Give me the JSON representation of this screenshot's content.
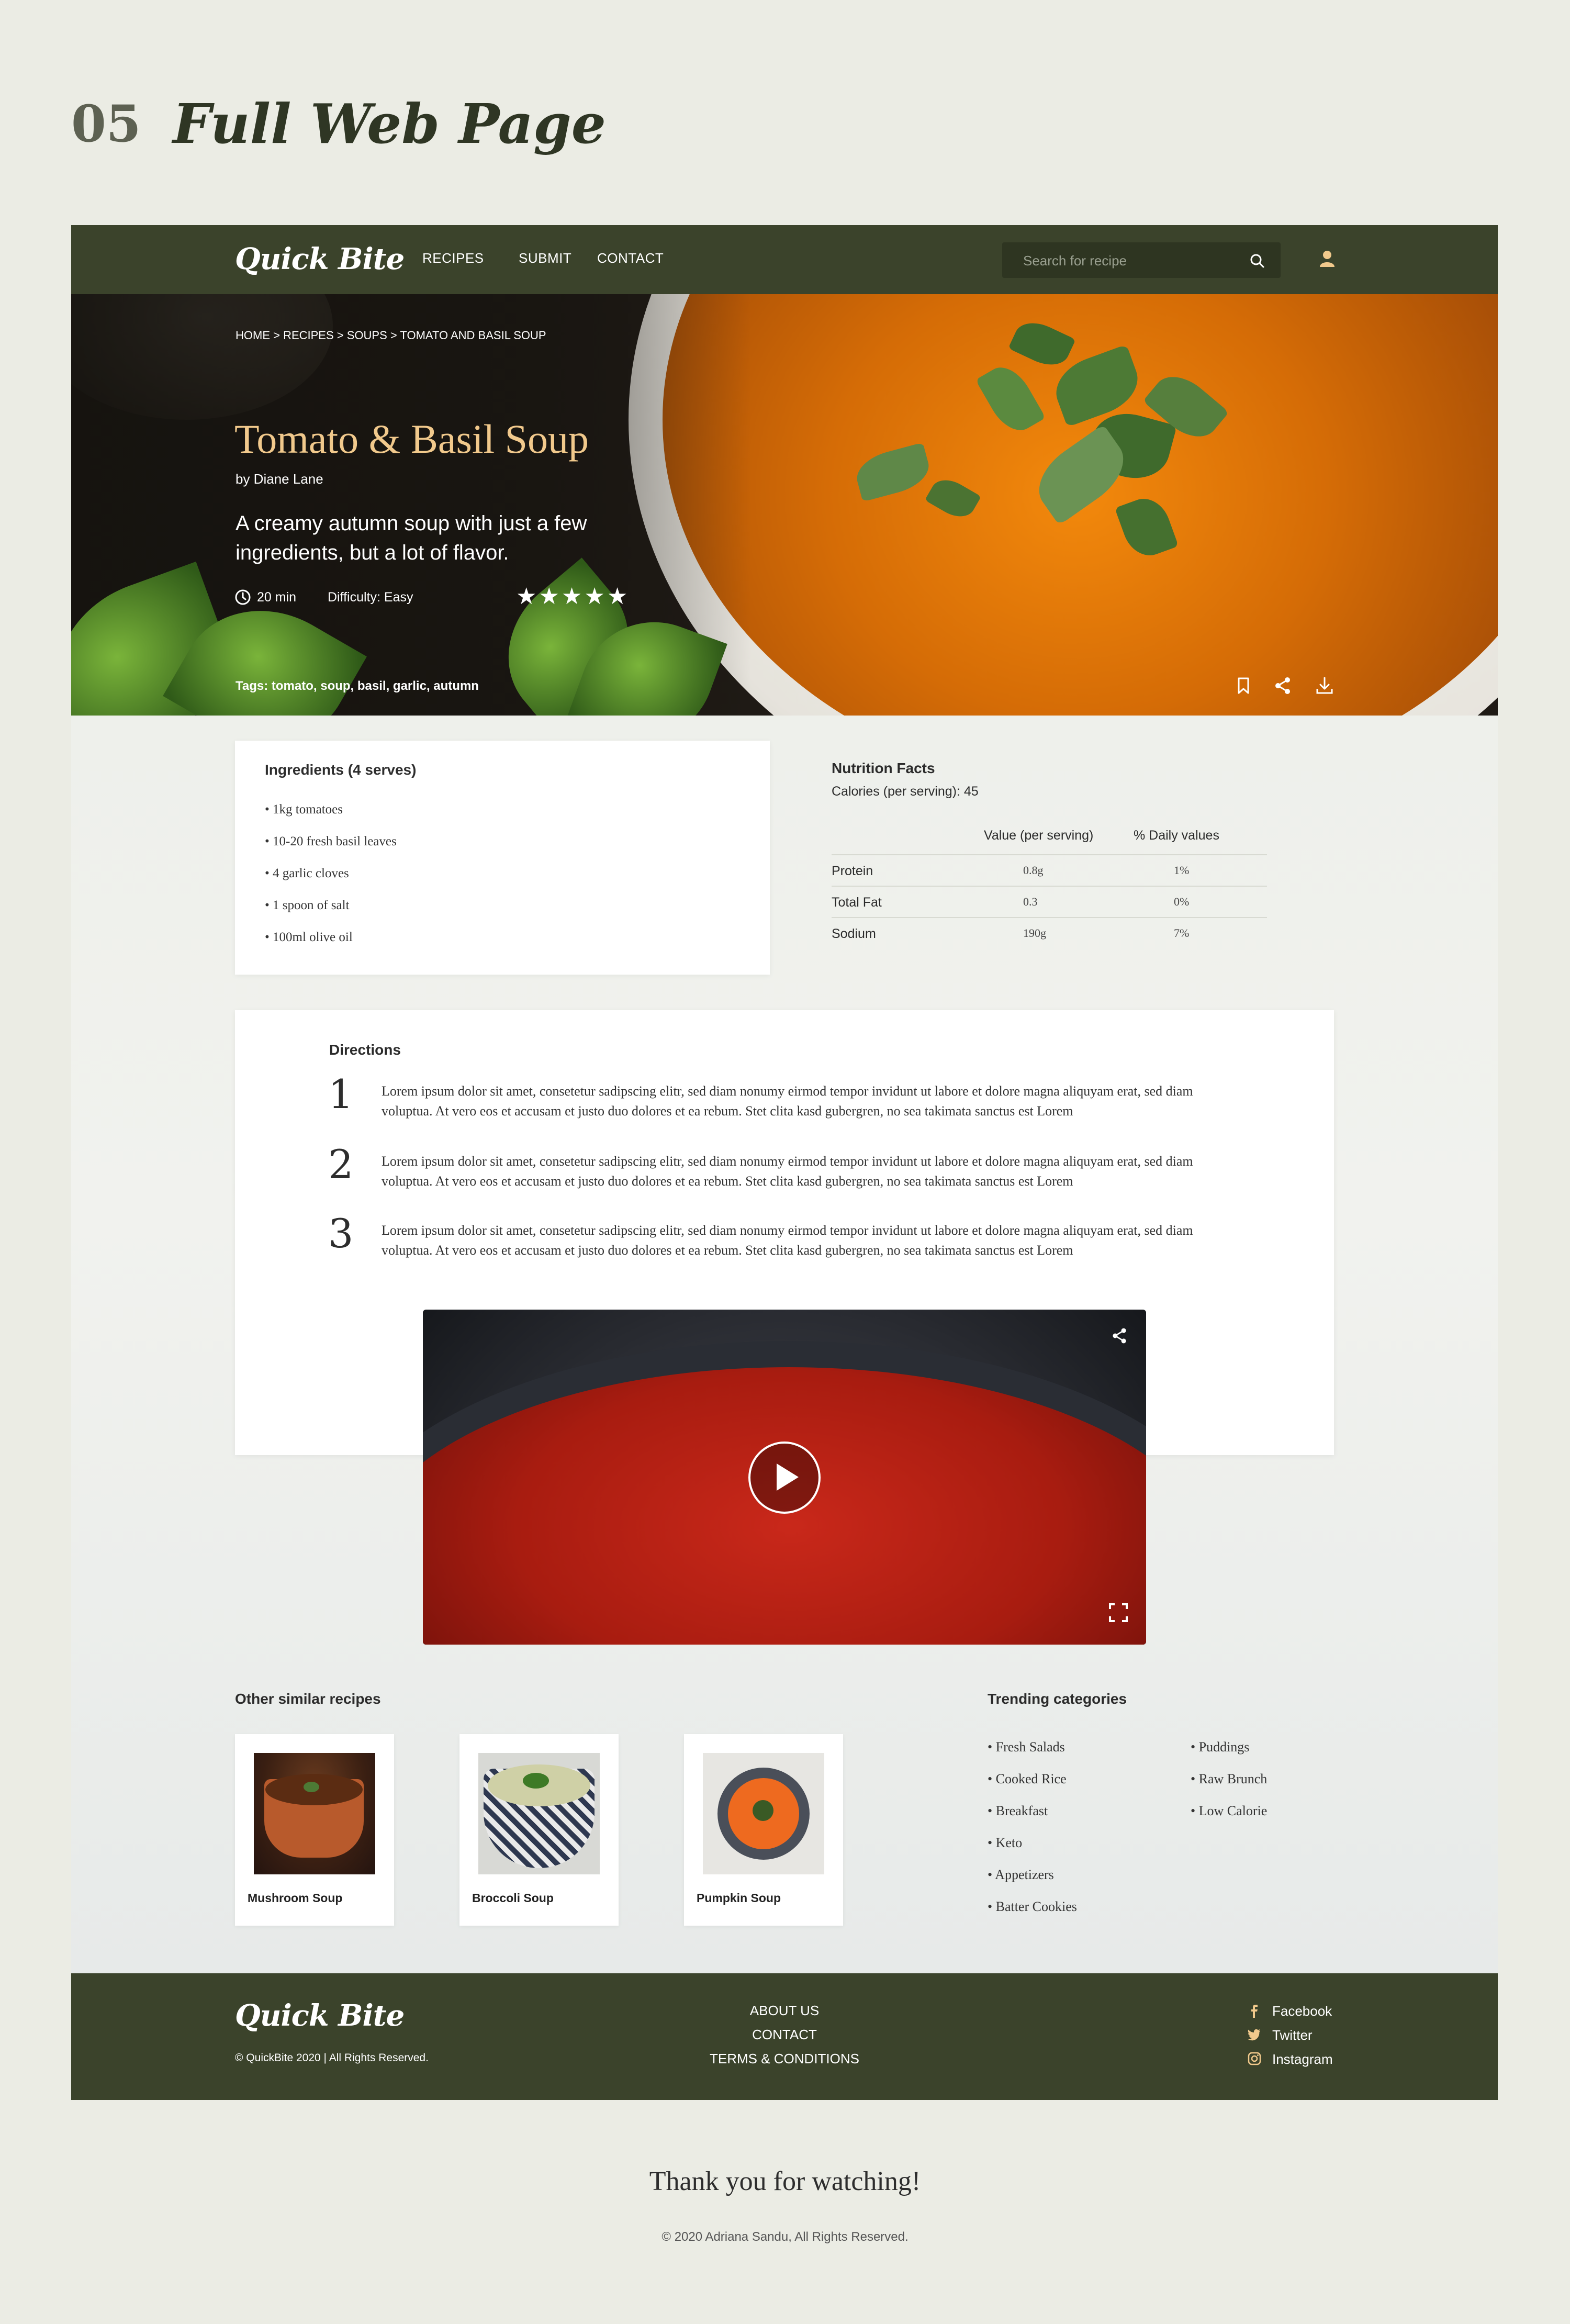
{
  "page_header": {
    "number": "05",
    "title": "Full Web Page"
  },
  "nav": {
    "logo": "Quick Bite",
    "links": [
      "RECIPES",
      "SUBMIT",
      "CONTACT"
    ],
    "search_placeholder": "Search for recipe"
  },
  "hero": {
    "breadcrumb": "HOME > RECIPES > SOUPS > TOMATO AND BASIL SOUP",
    "title": "Tomato & Basil Soup",
    "author": "by Diane Lane",
    "tagline": "A creamy autumn soup with just a few ingredients, but a lot of flavor.",
    "time": "20 min",
    "difficulty": "Difficulty: Easy",
    "rating": 5,
    "tags": "Tags: tomato, soup, basil, garlic, autumn"
  },
  "ingredients": {
    "title": "Ingredients (4 serves)",
    "items": [
      "• 1kg tomatoes",
      "• 10-20 fresh basil leaves",
      "• 4 garlic cloves",
      "• 1 spoon of salt",
      "• 100ml olive oil"
    ]
  },
  "nutrition": {
    "title": "Nutrition Facts",
    "calories": "Calories (per serving): 45",
    "headers": [
      "Value (per serving)",
      "% Daily values"
    ],
    "rows": [
      {
        "name": "Protein",
        "value": "0.8g",
        "daily": "1%"
      },
      {
        "name": "Total Fat",
        "value": "0.3",
        "daily": "0%"
      },
      {
        "name": "Sodium",
        "value": "190g",
        "daily": "7%"
      }
    ]
  },
  "directions": {
    "title": "Directions",
    "steps": [
      {
        "num": "1",
        "text": "Lorem ipsum dolor sit amet, consetetur sadipscing elitr, sed diam nonumy eirmod tempor invidunt ut labore et dolore magna aliquyam erat, sed diam voluptua. At vero eos et accusam et justo duo dolores et ea rebum. Stet clita kasd gubergren, no sea takimata sanctus est Lorem"
      },
      {
        "num": "2",
        "text": "Lorem ipsum dolor sit amet, consetetur sadipscing elitr, sed diam nonumy eirmod tempor invidunt ut labore et dolore magna aliquyam erat, sed diam voluptua. At vero eos et accusam et justo duo dolores et ea rebum. Stet clita kasd gubergren, no sea takimata sanctus est Lorem"
      },
      {
        "num": "3",
        "text": "Lorem ipsum dolor sit amet, consetetur sadipscing elitr, sed diam nonumy eirmod tempor invidunt ut labore et dolore magna aliquyam erat, sed diam voluptua. At vero eos et accusam et justo duo dolores et ea rebum. Stet clita kasd gubergren, no sea takimata sanctus est Lorem"
      }
    ]
  },
  "similar": {
    "title": "Other similar recipes",
    "items": [
      "Mushroom Soup",
      "Broccoli Soup",
      "Pumpkin Soup"
    ]
  },
  "trending": {
    "title": "Trending categories",
    "col1": [
      "• Fresh Salads",
      "• Cooked Rice",
      "• Breakfast",
      "• Keto",
      "• Appetizers",
      "• Batter Cookies"
    ],
    "col2": [
      "• Puddings",
      "• Raw Brunch",
      "• Low Calorie"
    ]
  },
  "footer": {
    "logo": "Quick Bite",
    "copyright": "© QuickBite 2020 | All Rights Reserved.",
    "links": [
      "ABOUT US",
      "CONTACT",
      "TERMS & CONDITIONS"
    ],
    "social": [
      "Facebook",
      "Twitter",
      "Instagram"
    ]
  },
  "closing": {
    "thanks": "Thank you for watching!",
    "credit": "© 2020 Adriana Sandu, All Rights Reserved."
  },
  "colors": {
    "nav_bg": "#3b432b",
    "title_gold": "#f1c98c",
    "page_bg": "#ebece4"
  }
}
